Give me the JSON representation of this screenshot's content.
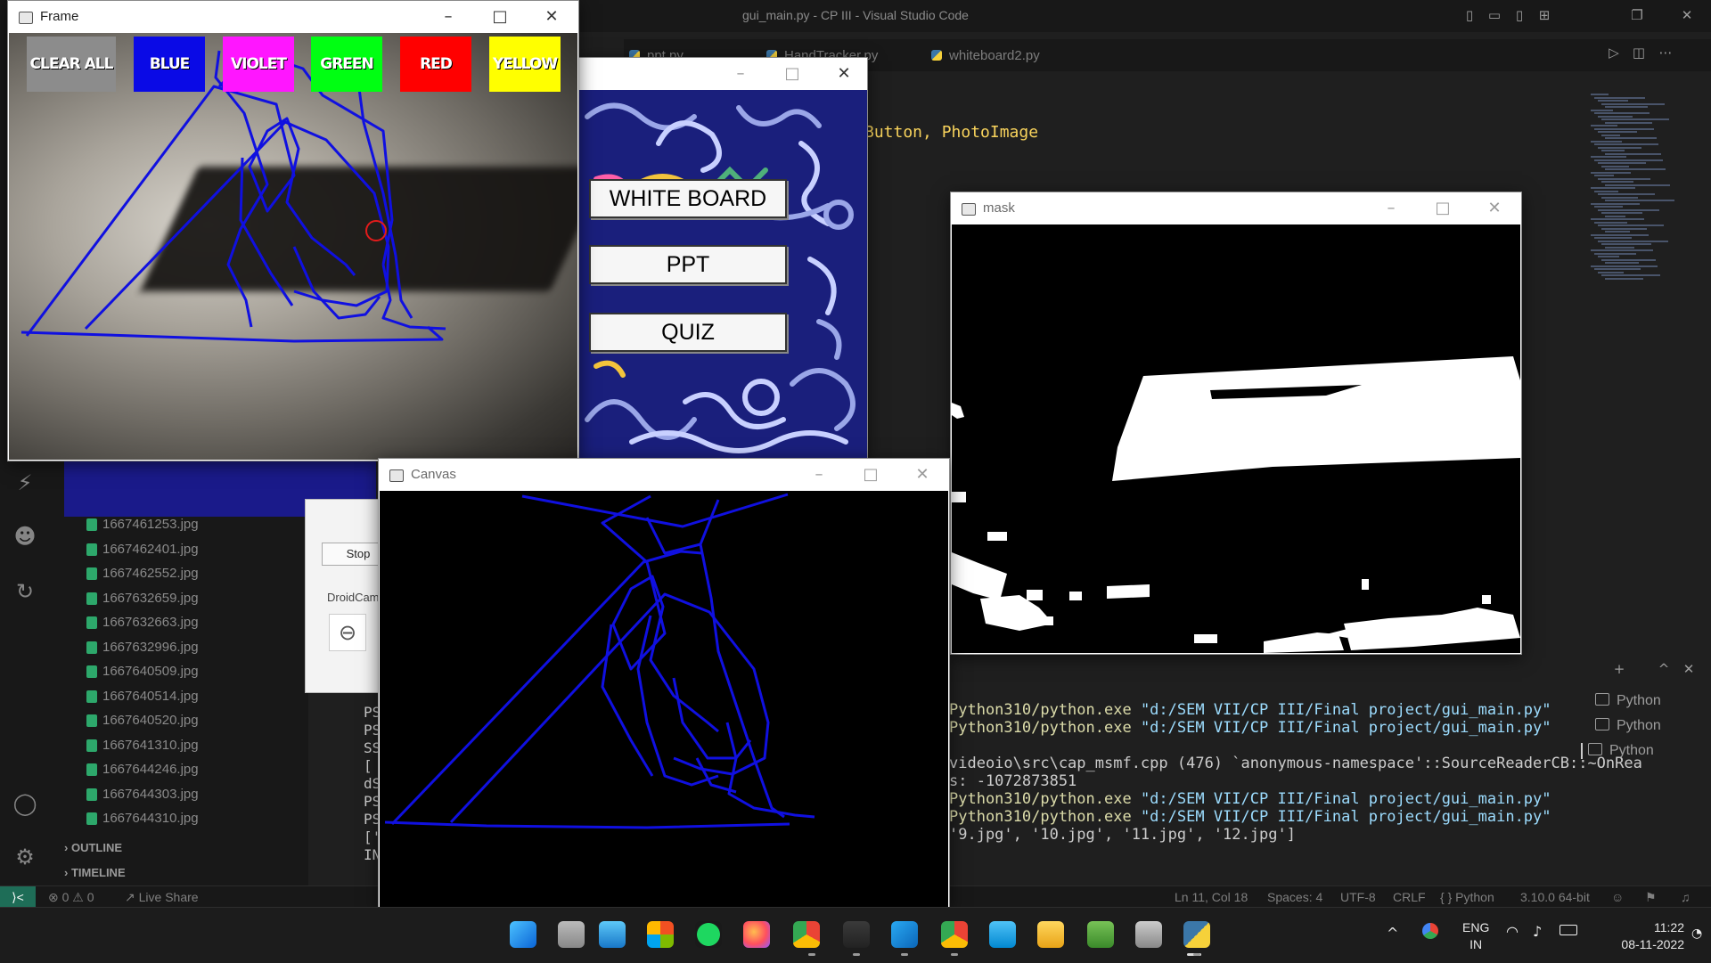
{
  "vscode": {
    "title": "gui_main.py - CP III - Visual Studio Code",
    "tabs": [
      "ppt.py",
      "HandTracker.py",
      "whiteboard2.py"
    ],
    "code_snippet": {
      "text": "Button, PhotoImage"
    },
    "files": [
      "1667461253.jpg",
      "1667462401.jpg",
      "1667462552.jpg",
      "1667632659.jpg",
      "1667632663.jpg",
      "1667632996.jpg",
      "1667640509.jpg",
      "1667640514.jpg",
      "1667640520.jpg",
      "1667641310.jpg",
      "1667644246.jpg",
      "1667644303.jpg",
      "1667644310.jpg"
    ],
    "sections": {
      "outline": "OUTLINE",
      "timeline": "TIMELINE"
    },
    "terminal": {
      "lines": [
        {
          "text": "Python310/python.exe ",
          "arg": "\"d:/SEM VII/CP III/Final project/gui_main.py\""
        },
        {
          "text": "Python310/python.exe ",
          "arg": "\"d:/SEM VII/CP III/Final project/gui_main.py\""
        },
        {
          "text": "",
          "arg": ""
        },
        {
          "text": "videoio\\src\\cap_msmf.cpp (476) `anonymous-namespace'::SourceReaderCB::~OnRea",
          "arg": ""
        },
        {
          "text": "s: -1072873851",
          "arg": ""
        },
        {
          "text": "Python310/python.exe ",
          "arg": "\"d:/SEM VII/CP III/Final project/gui_main.py\""
        },
        {
          "text": "Python310/python.exe ",
          "arg": "\"d:/SEM VII/CP III/Final project/gui_main.py\""
        },
        {
          "text": "'9.jpg', '10.jpg', '11.jpg', '12.jpg']",
          "arg": ""
        }
      ],
      "left_prefixes": [
        "PS",
        "PS",
        "SS",
        "[",
        "dS",
        "PS",
        "PS",
        "['",
        "IN",
        ""
      ],
      "tabs": [
        "Python",
        "Python",
        "Python"
      ]
    },
    "statusbar": {
      "errors": "0",
      "warnings": "0",
      "live_share": "Live Share",
      "position": "Ln 11, Col 18",
      "spaces": "Spaces: 4",
      "encoding": "UTF-8",
      "eol": "CRLF",
      "language": "Python",
      "interpreter": "3.10.0 64-bit"
    }
  },
  "frame_window": {
    "title": "Frame",
    "buttons": [
      {
        "label": "CLEAR ALL",
        "color": "#8c8c8c"
      },
      {
        "label": "BLUE",
        "color": "#0a0ae6"
      },
      {
        "label": "VIOLET",
        "color": "#ff16ff"
      },
      {
        "label": "GREEN",
        "color": "#00ff12"
      },
      {
        "label": "RED",
        "color": "#ff0000"
      },
      {
        "label": "YELLOW",
        "color": "#ffff00"
      }
    ]
  },
  "menu_window": {
    "buttons": [
      "WHITE BOARD",
      "PPT",
      "QUIZ"
    ]
  },
  "droidcam": {
    "stop": "Stop",
    "label": "DroidCam"
  },
  "mask_window": {
    "title": "mask"
  },
  "canvas_window": {
    "title": "Canvas",
    "stroke_color": "#1010e0"
  },
  "taskbar": {
    "lang_top": "ENG",
    "lang_bottom": "IN",
    "time": "11:22",
    "date": "08-11-2022"
  }
}
